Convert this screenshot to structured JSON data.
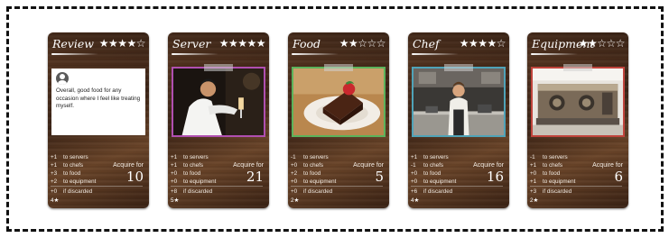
{
  "cards": [
    {
      "id": "review",
      "title": "Review",
      "stars": "★★★★☆",
      "border_color": "#ffffff",
      "review_text": "Overall, good food for any occasion where I feel like treating myself.",
      "stats": [
        {
          "value": "+1",
          "label": "to servers"
        },
        {
          "value": "+1",
          "label": "to chefs"
        },
        {
          "value": "+3",
          "label": "to food"
        },
        {
          "value": "+2",
          "label": "to equipment"
        }
      ],
      "acquire_label": "Acquire for",
      "acquire_value": "10",
      "discard_value": "+0",
      "discard_label": "if discarded",
      "tier": "4★"
    },
    {
      "id": "server",
      "title": "Server",
      "stars": "★★★★★",
      "border_color": "#b04fb0",
      "photo": "server-photo",
      "stats": [
        {
          "value": "+1",
          "label": "to servers"
        },
        {
          "value": "+1",
          "label": "to chefs"
        },
        {
          "value": "+0",
          "label": "to food"
        },
        {
          "value": "+0",
          "label": "to equipment"
        }
      ],
      "acquire_label": "Acquire for",
      "acquire_value": "21",
      "discard_value": "+8",
      "discard_label": "if discarded",
      "tier": "5★"
    },
    {
      "id": "food",
      "title": "Food",
      "stars": "★★☆☆☆",
      "border_color": "#5bb35b",
      "photo": "cake-photo",
      "stats": [
        {
          "value": "-1",
          "label": "to servers"
        },
        {
          "value": "+0",
          "label": "to chefs"
        },
        {
          "value": "+2",
          "label": "to food"
        },
        {
          "value": "+0",
          "label": "to equipment"
        }
      ],
      "acquire_label": "Acquire for",
      "acquire_value": "5",
      "discard_value": "+0",
      "discard_label": "if discarded",
      "tier": "2★"
    },
    {
      "id": "chef",
      "title": "Chef",
      "stars": "★★★★☆",
      "border_color": "#4fa3b8",
      "photo": "chef-photo",
      "stats": [
        {
          "value": "+1",
          "label": "to servers"
        },
        {
          "value": "-1",
          "label": "to chefs"
        },
        {
          "value": "+0",
          "label": "to food"
        },
        {
          "value": "+0",
          "label": "to equipment"
        }
      ],
      "acquire_label": "Acquire for",
      "acquire_value": "16",
      "discard_value": "+6",
      "discard_label": "if discarded",
      "tier": "4★"
    },
    {
      "id": "equipment",
      "title": "Equipment",
      "stars": "★★☆☆☆",
      "border_color": "#c0443c",
      "photo": "espresso-machine-photo",
      "stats": [
        {
          "value": "-1",
          "label": "to servers"
        },
        {
          "value": "+1",
          "label": "to chefs"
        },
        {
          "value": "+0",
          "label": "to food"
        },
        {
          "value": "+1",
          "label": "to equipment"
        }
      ],
      "acquire_label": "Acquire for",
      "acquire_value": "6",
      "discard_value": "+3",
      "discard_label": "if discarded",
      "tier": "2★"
    }
  ]
}
